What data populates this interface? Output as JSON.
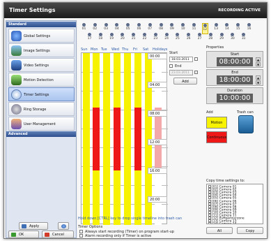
{
  "window": {
    "title": "Timer Settings",
    "status": "RECORDING ACTIVE"
  },
  "sidebar": {
    "section_standard": "Standard",
    "section_advanced": "Advanced",
    "items": [
      {
        "label": "Global Settings",
        "icon": "globe-icon"
      },
      {
        "label": "Image Settings",
        "icon": "image-icon"
      },
      {
        "label": "Video Settings",
        "icon": "video-icon"
      },
      {
        "label": "Motion Detection",
        "icon": "motion-icon"
      },
      {
        "label": "Timer Settings",
        "icon": "timer-icon"
      },
      {
        "label": "Ring Storage",
        "icon": "disk-icon"
      },
      {
        "label": "User Management",
        "icon": "users-icon"
      }
    ],
    "apply_label": "Apply",
    "ok_label": "OK",
    "cancel_label": "Cancel"
  },
  "days": {
    "row1": [
      "01",
      "02",
      "03",
      "04",
      "05",
      "06",
      "07",
      "08",
      "09",
      "10",
      "11",
      "12",
      "13",
      "14",
      "15",
      "16"
    ],
    "row2": [
      "17",
      "18",
      "19",
      "20",
      "21",
      "22",
      "23",
      "24",
      "25",
      "26",
      "27",
      "28",
      "29",
      "30",
      "31"
    ],
    "selected": "12"
  },
  "week": {
    "headers": [
      "Sun",
      "Mon",
      "Tue",
      "Wed",
      "Thu",
      "Fri",
      "Sat",
      "Holidays"
    ]
  },
  "hours": [
    "00:00",
    "04:00",
    "08:00",
    "12:00",
    "16:00",
    "20:00"
  ],
  "schedule": {
    "start_label": "Start",
    "start_date": "18.03.2011",
    "end_label": "End",
    "end_date": "23.03.2011",
    "add_label": "Add"
  },
  "properties": {
    "title": "Properties",
    "start_caption": "Start",
    "start_value": "08:00:00",
    "end_caption": "End",
    "end_value": "18:00:00",
    "duration_caption": "Duration",
    "duration_value": "10:00:00",
    "add_label": "Add",
    "trash_label": "Trash can",
    "motion_label": "Motion",
    "continuous_label": "Continuous",
    "copy_title": "Copy time settings to:",
    "cameras": [
      "[01] Camera 01",
      "[02] Camera 02",
      "[03] Camera 03",
      "[04] Camera 04",
      "[05] Camera 05",
      "[06] Camera 06",
      "[07] Camera 07",
      "[08] Camera 08",
      "[09] Camera 09",
      "[10] Camera 10",
      "[11] Camera 11",
      "[12] Puffgärtnerzone",
      "[13] Camera 13",
      "[14] Camera 14"
    ],
    "all_label": "All",
    "copy_label": "Copy"
  },
  "hint": "Hold down [CTRL] key to drop single timeline into trash can",
  "timer_options": {
    "title": "Timer Options",
    "opt1": "Always start recording (Timer) on program start-up",
    "opt2": "Alarm recording only if Timer is active"
  },
  "colors": {
    "motion": "#f6f200",
    "continuous": "#ee1818",
    "holiday": "#f3a9a9"
  }
}
